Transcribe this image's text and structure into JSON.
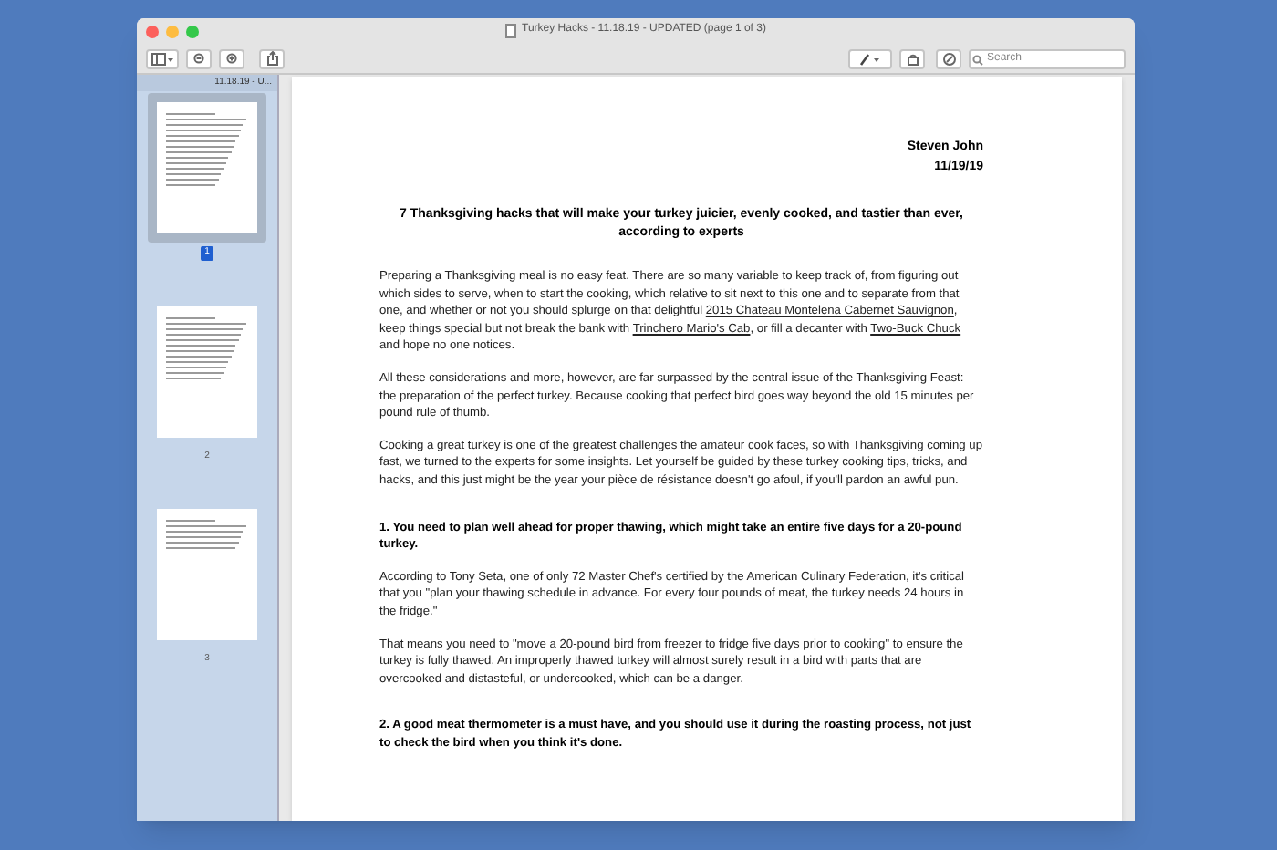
{
  "window": {
    "title": "Turkey Hacks - 11.18.19 - UPDATED (page 1 of 3)"
  },
  "toolbar": {
    "search": {
      "placeholder": "Search"
    }
  },
  "sidebar": {
    "header": "11.18.19 - U...",
    "pages": [
      {
        "label": "1",
        "selected": true
      },
      {
        "label": "2",
        "selected": false
      },
      {
        "label": "3",
        "selected": false
      }
    ]
  },
  "document": {
    "author": "Steven John",
    "date": "11/19/19",
    "title": "7 Thanksgiving hacks that will make your turkey juicier, evenly cooked, and tastier than ever, according to experts",
    "paragraphs": [
      {
        "kind": "text",
        "segments": [
          {
            "text": "Preparing a Thanksgiving meal is no easy feat. There are so many variable to keep track of, from figuring out which sides to serve, when to start the cooking, which relative to sit next to this one and to separate from that one, and whether or not you should splurge on that delightful ",
            "kind": "plain"
          },
          {
            "text": "2015 Chateau Montelena Cabernet Sauvignon",
            "kind": "link"
          },
          {
            "text": ", keep things special but not break the bank with ",
            "kind": "plain"
          },
          {
            "text": "Trinchero Mario's Cab",
            "kind": "link"
          },
          {
            "text": ", or fill a decanter with ",
            "kind": "plain"
          },
          {
            "text": "Two-Buck Chuck",
            "kind": "link"
          },
          {
            "text": " and hope no one notices.",
            "kind": "plain"
          }
        ]
      },
      {
        "kind": "text",
        "segments": [
          {
            "text": "All these considerations and more, however, are far surpassed by the central issue of the Thanksgiving Feast: the preparation of the perfect turkey. Because cooking that perfect bird goes way beyond the old 15 minutes per pound rule of thumb.",
            "kind": "plain"
          }
        ]
      },
      {
        "kind": "text",
        "segments": [
          {
            "text": "Cooking a great turkey is one of the greatest challenges the amateur cook faces, so with Thanksgiving coming up fast, we turned to the experts for some insights. Let yourself be guided by these turkey cooking tips, tricks, and hacks, and this just might be the year your pièce de résistance doesn't go afoul, if you'll pardon an awful pun.",
            "kind": "plain"
          }
        ]
      },
      {
        "kind": "heading",
        "segments": [
          {
            "text": "1. You need to plan well ahead for proper thawing, which might take an entire five days for a 20-pound turkey.",
            "kind": "plain"
          }
        ]
      },
      {
        "kind": "text",
        "segments": [
          {
            "text": "According to Tony Seta, one of only 72 Master Chef's certified by the American Culinary Federation, it's critical that you \"plan your thawing schedule in advance. For every four pounds of meat, the turkey needs 24 hours in the fridge.\"",
            "kind": "plain"
          }
        ]
      },
      {
        "kind": "text",
        "segments": [
          {
            "text": "That means you need to \"move a 20-pound bird from freezer to fridge five days prior to cooking\" to ensure the turkey is fully thawed. An improperly thawed turkey will almost surely result in a bird with parts that are overcooked and distasteful, or undercooked, which can be a danger.",
            "kind": "plain"
          }
        ]
      },
      {
        "kind": "heading",
        "segments": [
          {
            "text": "2. A good meat thermometer is a must have, and you should use it during the roasting process, not just to check the bird when you think it's done.",
            "kind": "plain"
          }
        ]
      }
    ]
  }
}
